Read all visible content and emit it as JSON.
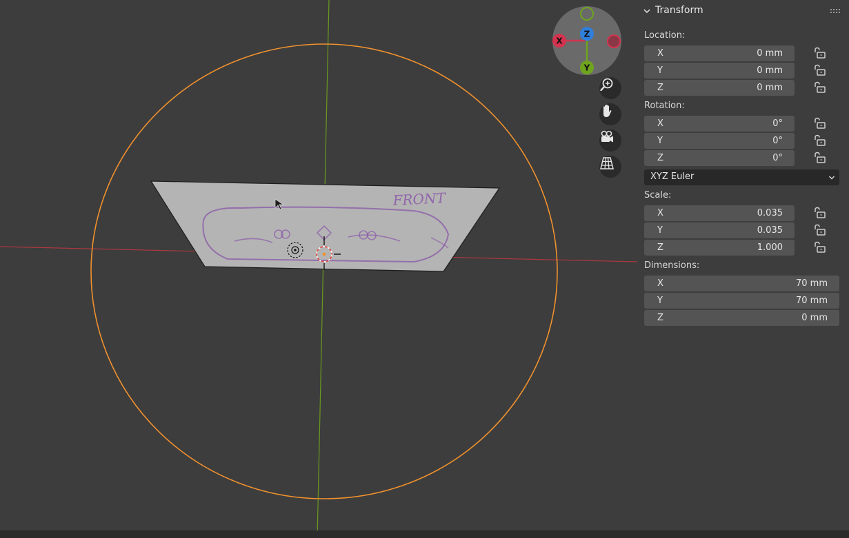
{
  "viewport": {
    "gizmo": {
      "x_label": "X",
      "y_label": "Y",
      "z_label": "Z",
      "x_color": "#d4334f",
      "y_color": "#6fa51e",
      "z_color": "#2f7fdc"
    },
    "nav_buttons": [
      "zoom-icon",
      "hand-pan-icon",
      "camera-icon",
      "grid-ortho-icon"
    ],
    "plane_text": "FRONT",
    "selection_color": "#f0912e",
    "x_axis_color": "#b0383f",
    "y_axis_color": "#6a9a1f"
  },
  "panel": {
    "title": "Transform",
    "location": {
      "label": "Location:",
      "rows": [
        {
          "axis": "X",
          "value": "0 mm"
        },
        {
          "axis": "Y",
          "value": "0 mm"
        },
        {
          "axis": "Z",
          "value": "0 mm"
        }
      ]
    },
    "rotation": {
      "label": "Rotation:",
      "rows": [
        {
          "axis": "X",
          "value": "0°"
        },
        {
          "axis": "Y",
          "value": "0°"
        },
        {
          "axis": "Z",
          "value": "0°"
        }
      ],
      "mode": "XYZ Euler"
    },
    "scale": {
      "label": "Scale:",
      "rows": [
        {
          "axis": "X",
          "value": "0.035"
        },
        {
          "axis": "Y",
          "value": "0.035"
        },
        {
          "axis": "Z",
          "value": "1.000"
        }
      ]
    },
    "dimensions": {
      "label": "Dimensions:",
      "rows": [
        {
          "axis": "X",
          "value": "70 mm"
        },
        {
          "axis": "Y",
          "value": "70 mm"
        },
        {
          "axis": "Z",
          "value": "0 mm"
        }
      ]
    }
  }
}
